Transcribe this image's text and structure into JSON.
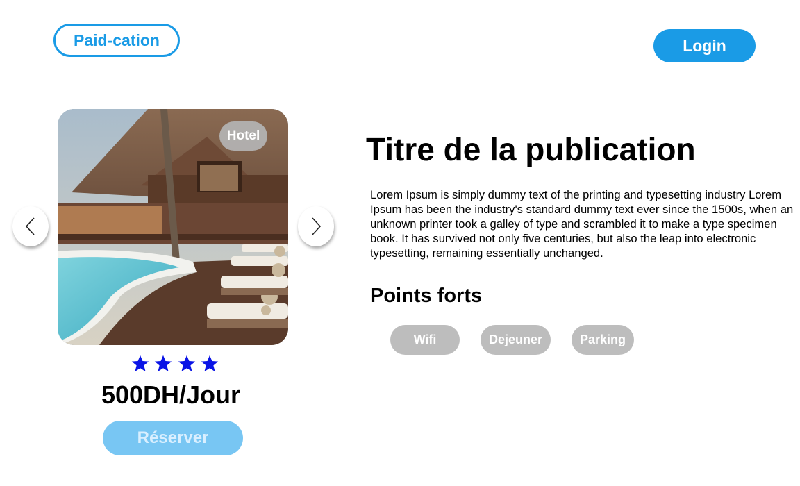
{
  "header": {
    "brand": "Paid-cation",
    "login_label": "Login"
  },
  "listing": {
    "category_badge": "Hotel",
    "rating": 4,
    "price": "500DH/Jour",
    "reserve_label": "Réserver",
    "title": "Titre de la publication",
    "description": "Lorem Ipsum is simply dummy text of the printing and typesetting industry Lorem Ipsum has been the industry's standard dummy text ever since the 1500s, when an unknown printer took a galley of type and scrambled it to make a type specimen book. It has survived not only five centuries, but also the leap into electronic typesetting, remaining essentially unchanged.",
    "strengths_title": "Points forts",
    "strengths": [
      "Wifi",
      "Dejeuner",
      "Parking"
    ]
  },
  "icons": {
    "previous": "chevron-left-icon",
    "next": "chevron-right-icon",
    "star": "star-icon"
  },
  "colors": {
    "accent": "#1a9be6",
    "reserve": "#78c6f3",
    "chip": "#bdbdbd",
    "star": "#0a14e6"
  }
}
